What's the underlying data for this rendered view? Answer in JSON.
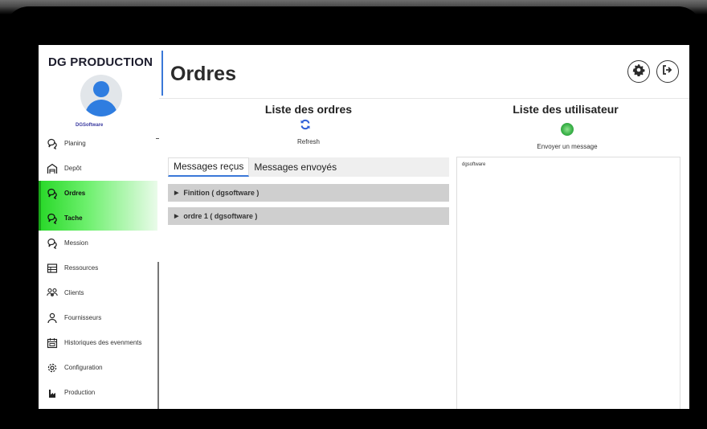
{
  "sidebar": {
    "brand": "DG PRODUCTION",
    "sub_brand": "DGSoftware",
    "items": [
      {
        "label": "Planing",
        "icon": "chat-bubbles-icon",
        "active": false
      },
      {
        "label": "Depôt",
        "icon": "warehouse-icon",
        "active": false
      },
      {
        "label": "Ordres",
        "icon": "chat-bubbles-icon",
        "active": true
      },
      {
        "label": "Tache",
        "icon": "chat-bubbles-icon",
        "active": true
      },
      {
        "label": "Mession",
        "icon": "chat-bubbles-icon",
        "active": false
      },
      {
        "label": "Ressources",
        "icon": "table-icon",
        "active": false
      },
      {
        "label": "Clients",
        "icon": "people-icon",
        "active": false
      },
      {
        "label": "Fournisseurs",
        "icon": "person-icon",
        "active": false
      },
      {
        "label": "Historiques des evenments",
        "icon": "calendar-icon",
        "active": false
      },
      {
        "label": "Configuration",
        "icon": "gear-icon",
        "active": false
      },
      {
        "label": "Production",
        "icon": "factory-icon",
        "active": false
      }
    ]
  },
  "header": {
    "title": "Ordres",
    "settings_icon": "gear-icon",
    "logout_icon": "logout-icon"
  },
  "orders": {
    "title": "Liste des ordres",
    "refresh_label": "Refresh",
    "tabs": [
      "Messages reçus",
      "Messages envoyés"
    ],
    "active_tab": 0,
    "items": [
      "Finition ( dgsoftware )",
      "ordre 1 ( dgsoftware )"
    ]
  },
  "users": {
    "title": "Liste des utilisateur",
    "send_label": "Envoyer un message",
    "list": [
      "dgsoftware"
    ]
  },
  "colors": {
    "accent_blue": "#3a78d8",
    "active_green": "#2bd92b",
    "refresh_blue": "#2f5fd8"
  }
}
